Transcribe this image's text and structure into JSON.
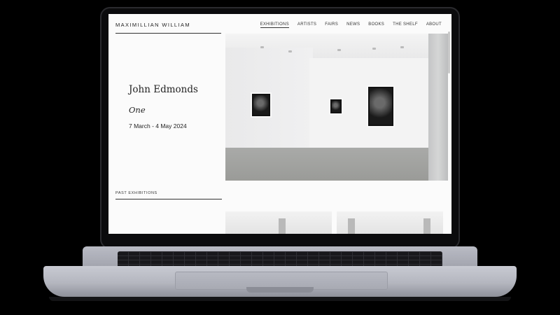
{
  "site": {
    "logo": "MAXIMILLIAN WILLIAM"
  },
  "nav": {
    "items": [
      "EXHIBITIONS",
      "ARTISTS",
      "FAIRS",
      "NEWS",
      "BOOKS",
      "THE SHELF",
      "ABOUT"
    ],
    "active": "EXHIBITIONS"
  },
  "exhibition": {
    "artist": "John Edmonds",
    "title": "One",
    "dates": "7 March - 4 May 2024"
  },
  "sections": {
    "past_label": "PAST EXHIBITIONS"
  }
}
